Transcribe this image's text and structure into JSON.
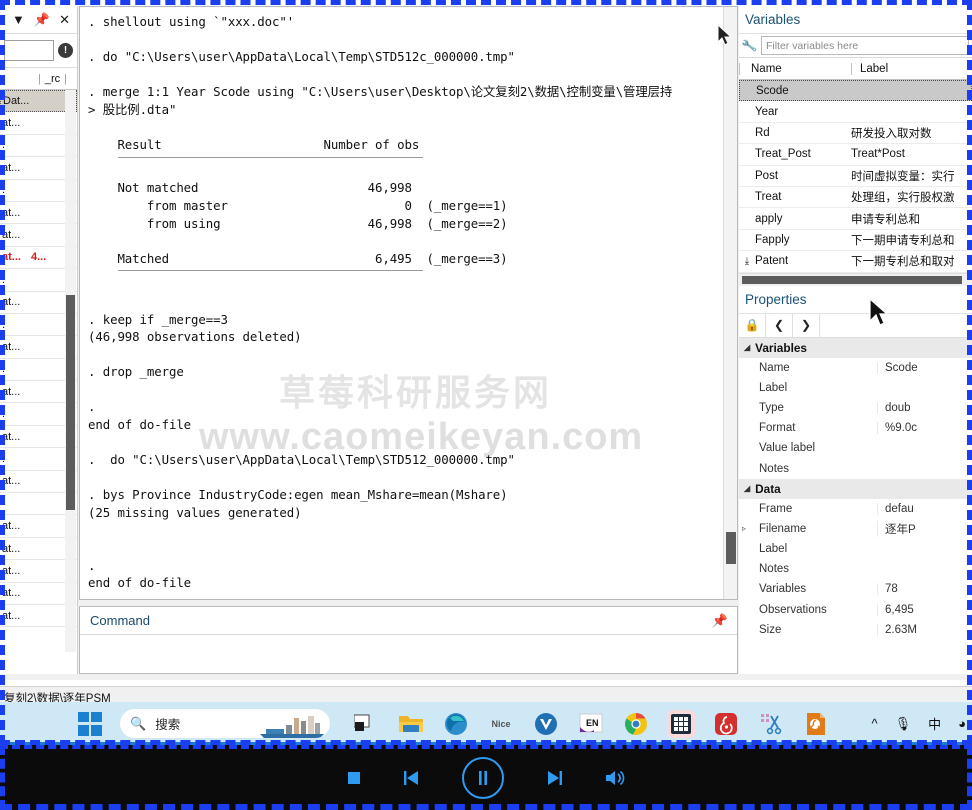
{
  "review_panel": {
    "titlebar_icons": [
      "filter-icon",
      "pin-icon",
      "close-icon"
    ],
    "filter_value": "",
    "warn_icon": "!",
    "column_header": "_rc",
    "rows": [
      {
        "text": "at...",
        "red": false
      },
      {
        "text": "at...",
        "red": false
      },
      {
        "text": "at...",
        "red": false
      },
      {
        "text": "at...",
        "red": false
      },
      {
        "text": "at...",
        "red": false
      },
      {
        "text": "",
        "red": false
      },
      {
        "text": "at...",
        "red": false
      },
      {
        "text": ".",
        "red": false
      },
      {
        "text": "at...",
        "red": false
      },
      {
        "text": ".",
        "red": false
      },
      {
        "text": "at...",
        "red": false
      },
      {
        "text": ".",
        "red": false
      },
      {
        "text": "at...",
        "red": false
      },
      {
        "text": ".",
        "red": false
      },
      {
        "text": "at...",
        "red": false
      },
      {
        "text": ".",
        "red": false
      },
      {
        "text": "at...",
        "red": true,
        "num": "4..."
      },
      {
        "text": "at...",
        "red": false
      },
      {
        "text": "at...",
        "red": false
      },
      {
        "text": ".",
        "red": false
      },
      {
        "text": "at...",
        "red": false
      },
      {
        "text": ".",
        "red": false
      },
      {
        "text": "at...",
        "red": false
      },
      {
        "text": "Dat...",
        "red": false,
        "selected": true
      }
    ]
  },
  "console": {
    "lines": [
      ". shellout using `\"xxx.doc\"'",
      "",
      ". do \"C:\\Users\\user\\AppData\\Local\\Temp\\STD512c_000000.tmp\"",
      "",
      ". merge 1:1 Year Scode using \"C:\\Users\\user\\Desktop\\论文复刻2\\数据\\控制变量\\管理层持",
      "> 股比例.dta\"",
      "",
      "    Result                      Number of obs",
      "",
      "    Not matched                       46,998",
      "        from master                        0  (_merge==1)",
      "        from using                    46,998  (_merge==2)",
      "",
      "    Matched                            6,495  (_merge==3)",
      "",
      "",
      ". keep if _merge==3",
      "(46,998 observations deleted)",
      "",
      ". drop _merge",
      "",
      ".",
      "end of do-file",
      "",
      ".  do \"C:\\Users\\user\\AppData\\Local\\Temp\\STD512_000000.tmp\"",
      "",
      ". bys Province IndustryCode:egen mean_Mshare=mean(Mshare)",
      "(25 missing values generated)",
      "",
      "",
      ".",
      "end of do-file",
      "",
      "",
      "."
    ],
    "watermark_cn": "草莓科研服务网",
    "watermark_en": "www.caomeikeyan.com"
  },
  "command_panel": {
    "title": "Command",
    "pin_icon": "pin-icon",
    "value": ""
  },
  "variables_panel": {
    "title": "Variables",
    "wrench_icon": "wrench-icon",
    "filter_placeholder": "Filter variables here",
    "columns": [
      "Name",
      "Label"
    ],
    "rows": [
      {
        "name": "Scode",
        "label": "",
        "selected": true,
        "icon": ""
      },
      {
        "name": "Year",
        "label": "",
        "icon": ""
      },
      {
        "name": "Rd",
        "label": "研发投入取对数",
        "icon": ""
      },
      {
        "name": "Treat_Post",
        "label": "Treat*Post",
        "icon": ""
      },
      {
        "name": "Post",
        "label": "时间虚拟变量：实行",
        "icon": ""
      },
      {
        "name": "Treat",
        "label": "处理组，实行股权激",
        "icon": ""
      },
      {
        "name": "apply",
        "label": "申请专利总和",
        "icon": ""
      },
      {
        "name": "Fapply",
        "label": "下一期申请专利总和",
        "icon": ""
      },
      {
        "name": "Patent",
        "label": "下一期专利总和取对",
        "icon": "download-icon"
      }
    ]
  },
  "properties_panel": {
    "title": "Properties",
    "toolbar_icons": [
      "lock-icon",
      "chevron-left-icon",
      "chevron-right-icon"
    ],
    "groups": [
      {
        "name": "Variables",
        "rows": [
          {
            "key": "Name",
            "value": "Scode"
          },
          {
            "key": "Label",
            "value": ""
          },
          {
            "key": "Type",
            "value": "doub"
          },
          {
            "key": "Format",
            "value": "%9.0c"
          },
          {
            "key": "Value label",
            "value": ""
          },
          {
            "key": "Notes",
            "value": ""
          }
        ]
      },
      {
        "name": "Data",
        "rows": [
          {
            "key": "Frame",
            "value": "defau"
          },
          {
            "key": "Filename",
            "value": "逐年P",
            "expandable": true
          },
          {
            "key": "Label",
            "value": ""
          },
          {
            "key": "Notes",
            "value": ""
          },
          {
            "key": "Variables",
            "value": "78"
          },
          {
            "key": "Observations",
            "value": "6,495"
          },
          {
            "key": "Size",
            "value": "2.63M"
          }
        ]
      }
    ]
  },
  "status_bar": {
    "path": "复刻2\\数据\\逐年PSM"
  },
  "taskbar": {
    "start_icon": "windows-logo-icon",
    "search_placeholder": "搜索",
    "search_icon": "search-icon",
    "items": [
      {
        "name": "task-view-icon",
        "label": ""
      },
      {
        "name": "file-explorer-icon",
        "label": ""
      },
      {
        "name": "edge-browser-icon",
        "label": ""
      },
      {
        "name": "nice-app-icon",
        "label": "Nice"
      },
      {
        "name": "v-app-icon",
        "label": ""
      },
      {
        "name": "input-method-en-icon",
        "label": "EN"
      },
      {
        "name": "chrome-browser-icon",
        "label": ""
      },
      {
        "name": "calculator-app-icon",
        "label": ""
      },
      {
        "name": "netease-music-icon",
        "label": ""
      },
      {
        "name": "snipping-tool-icon",
        "label": ""
      },
      {
        "name": "pdf-app-icon",
        "label": ""
      }
    ],
    "tray": [
      {
        "name": "show-hidden-icons-chevron",
        "glyph": "⌃"
      },
      {
        "name": "microphone-icon",
        "glyph": "A"
      },
      {
        "name": "ime-chinese-icon",
        "glyph": "中"
      },
      {
        "name": "wifi-icon",
        "glyph": "◔"
      }
    ]
  },
  "player": {
    "buttons": [
      {
        "name": "stop-button",
        "glyph": "■"
      },
      {
        "name": "previous-button",
        "glyph": "◀"
      },
      {
        "name": "pause-button",
        "glyph": "‖"
      },
      {
        "name": "next-button",
        "glyph": "▶"
      },
      {
        "name": "volume-button",
        "glyph": "◀"
      }
    ]
  },
  "colors": {
    "accent_blue": "#1b7fd0",
    "rec_border": "#1b3ff0",
    "panel_title": "#1a5276",
    "error_red": "#d01a1a"
  }
}
